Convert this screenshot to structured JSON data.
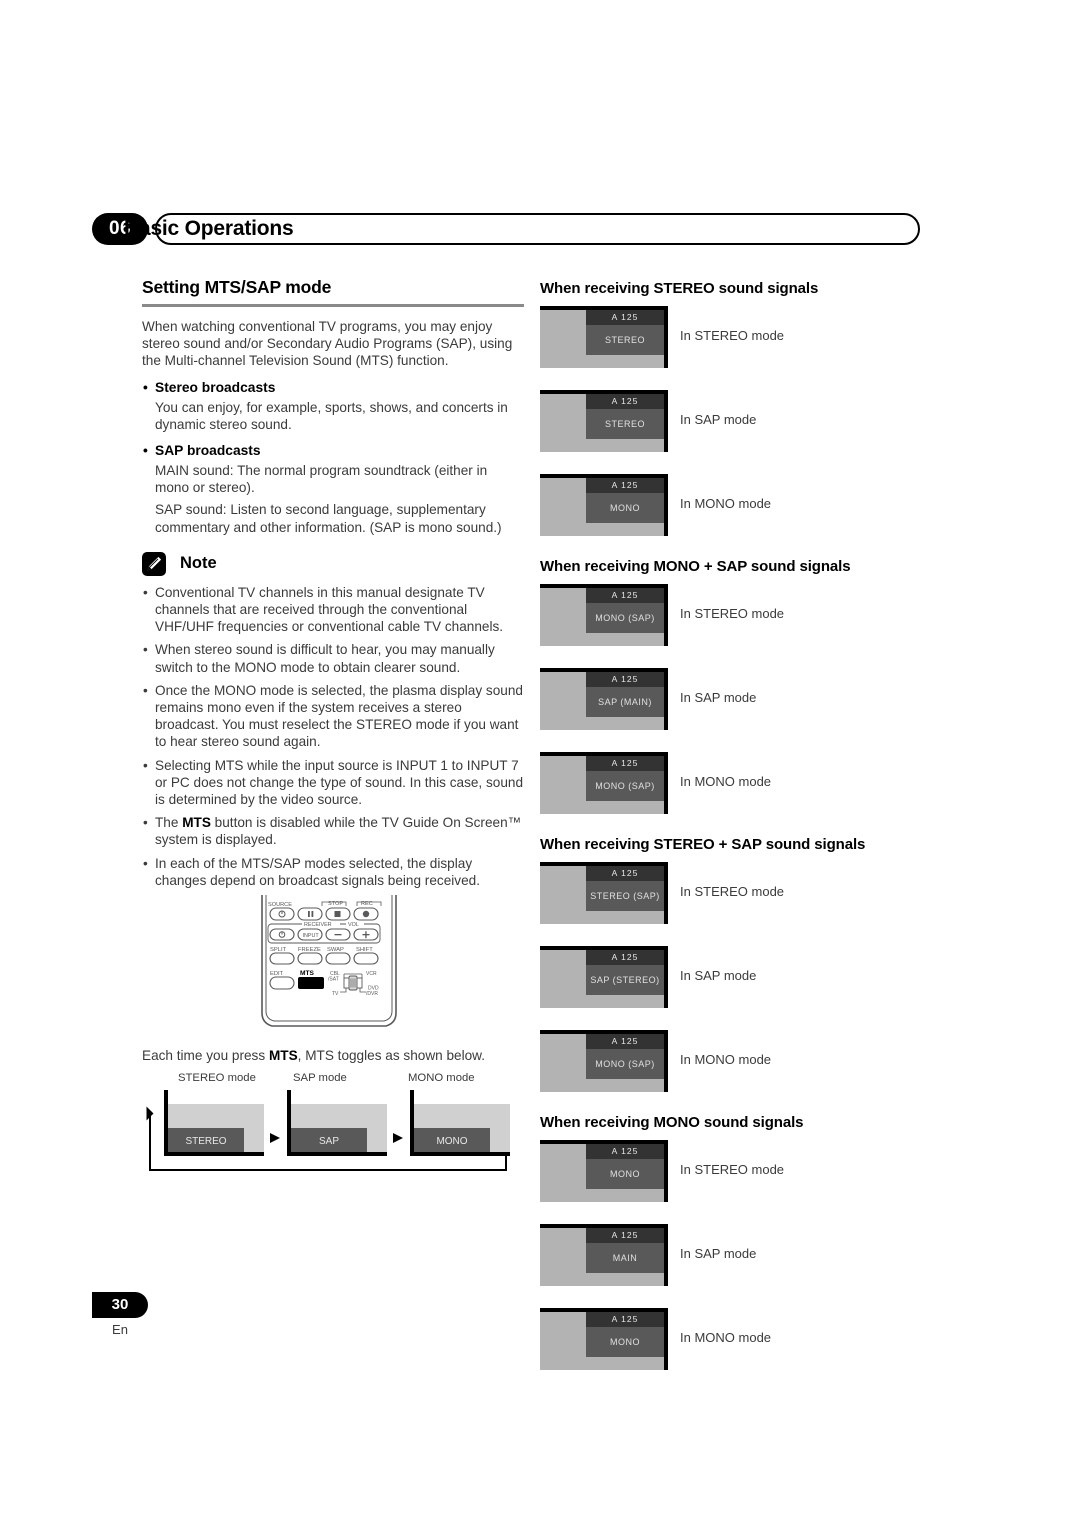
{
  "header": {
    "chapter_number": "06",
    "chapter_title": "Basic Operations"
  },
  "left_column": {
    "section_title": "Setting MTS/SAP mode",
    "intro": "When watching conventional TV programs, you may enjoy stereo sound and/or Secondary Audio Programs (SAP), using the Multi-channel Television Sound (MTS) function.",
    "stereo_broadcasts_heading": "Stereo broadcasts",
    "stereo_broadcasts_body": "You can enjoy, for example, sports, shows, and concerts in dynamic stereo sound.",
    "sap_broadcasts_heading": "SAP broadcasts",
    "sap_main_body": "MAIN sound: The normal program soundtrack (either in mono or stereo).",
    "sap_sap_body": "SAP sound: Listen to second language, supplementary commentary and other information. (SAP is mono sound.)",
    "note_label": "Note",
    "note_icon": "pencil-icon",
    "notes": [
      "Conventional TV channels in this manual designate TV channels that are received through the conventional VHF/UHF frequencies or conventional cable TV channels.",
      "When stereo sound is difficult to hear, you may manually switch to the MONO mode to obtain clearer sound.",
      "Once the MONO mode is selected, the plasma display sound remains mono even if the system receives a stereo broadcast. You must reselect the STEREO mode if you want to hear stereo sound again.",
      "Selecting MTS while the input source is INPUT 1 to INPUT 7 or PC does not change the type of sound. In this case, sound is determined by the video source.",
      "The MTS button is disabled while the TV Guide On Screen™ system is displayed.",
      "In each of the MTS/SAP modes selected, the display changes depend on broadcast signals being received."
    ],
    "note_bold_terms": [
      "MTS"
    ],
    "remote": {
      "name": "remote-control-illustration",
      "highlighted_button": "MTS",
      "row_labels_top": [
        "SOURCE",
        "STOP",
        "REC"
      ],
      "row_labels_receiver": [
        "RECEIVER",
        "INPUT",
        "VOL"
      ],
      "row_labels_functions": [
        "SPLIT",
        "FREEZE",
        "SWAP",
        "SHIFT"
      ],
      "row_labels_bottom": [
        "EDIT",
        "MTS"
      ],
      "selector_labels": [
        "CBL",
        "/SAT",
        "VCR",
        "TV",
        "DVD",
        "/DVR"
      ],
      "vol_minus": "–",
      "vol_plus": "+"
    },
    "toggle_caption_pre": "Each time you press ",
    "toggle_caption_bold": "MTS",
    "toggle_caption_post": ", MTS toggles as shown below.",
    "toggle_steps": [
      {
        "label": "STEREO mode",
        "chip": "STEREO"
      },
      {
        "label": "SAP mode",
        "chip": "SAP"
      },
      {
        "label": "MONO mode",
        "chip": "MONO"
      }
    ]
  },
  "right_column": {
    "sections": [
      {
        "title": "When receiving STEREO sound signals",
        "shots": [
          {
            "channel": "A  125",
            "mode_text": "STEREO",
            "caption": "In STEREO mode"
          },
          {
            "channel": "A  125",
            "mode_text": "STEREO",
            "caption": "In SAP mode"
          },
          {
            "channel": "A  125",
            "mode_text": "MONO",
            "caption": "In MONO mode"
          }
        ]
      },
      {
        "title": "When receiving MONO + SAP sound signals",
        "shots": [
          {
            "channel": "A  125",
            "mode_text": "MONO (SAP)",
            "caption": "In STEREO mode"
          },
          {
            "channel": "A  125",
            "mode_text": "SAP (MAIN)",
            "caption": "In SAP mode"
          },
          {
            "channel": "A  125",
            "mode_text": "MONO (SAP)",
            "caption": "In MONO mode"
          }
        ]
      },
      {
        "title": "When receiving STEREO + SAP sound signals",
        "shots": [
          {
            "channel": "A  125",
            "mode_text": "STEREO (SAP)",
            "caption": "In STEREO mode"
          },
          {
            "channel": "A  125",
            "mode_text": "SAP (STEREO)",
            "caption": "In SAP mode"
          },
          {
            "channel": "A  125",
            "mode_text": "MONO (SAP)",
            "caption": "In MONO mode"
          }
        ]
      },
      {
        "title": "When receiving MONO sound signals",
        "shots": [
          {
            "channel": "A  125",
            "mode_text": "MONO",
            "caption": "In STEREO mode"
          },
          {
            "channel": "A  125",
            "mode_text": "MAIN",
            "caption": "In SAP mode"
          },
          {
            "channel": "A  125",
            "mode_text": "MONO",
            "caption": "In MONO mode"
          }
        ]
      }
    ]
  },
  "footer": {
    "page_number": "30",
    "language": "En"
  },
  "colors": {
    "ink": "#231f20",
    "body_text": "#3b3b3b",
    "rule": "#8a8a8a",
    "screen_body": "#b3b3b3",
    "osd_channel_bg": "#333333",
    "osd_mode_bg": "#595959",
    "chip_light": "#d0d0d0",
    "chip_dark": "#595959"
  }
}
